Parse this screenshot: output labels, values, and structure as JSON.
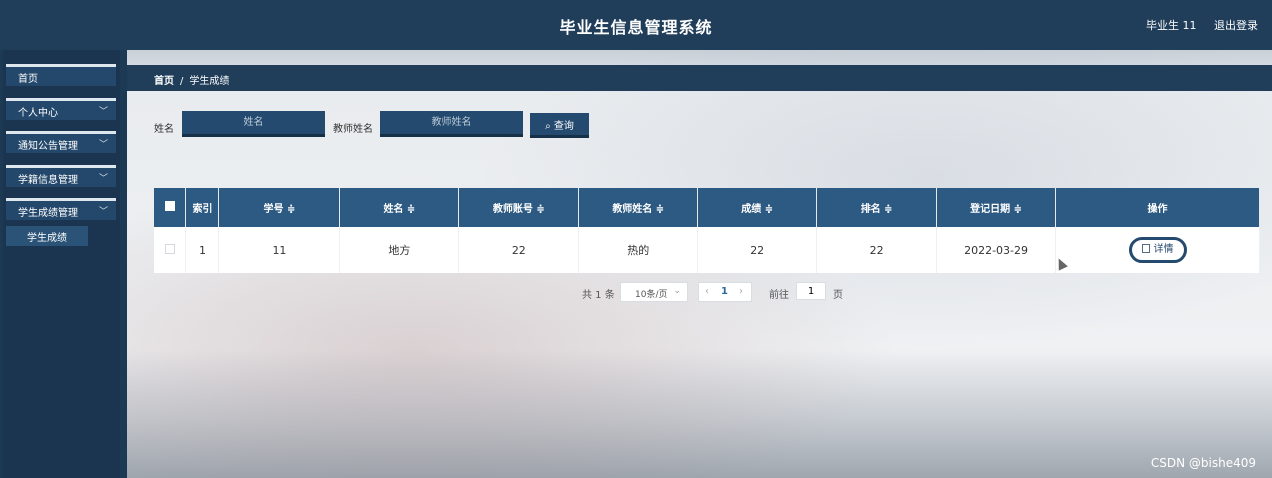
{
  "app": {
    "title": "毕业生信息管理系统",
    "user_label": "毕业生 11",
    "logout_label": "退出登录"
  },
  "sidebar": {
    "items": [
      {
        "label": "首页"
      },
      {
        "label": "个人中心"
      },
      {
        "label": "通知公告管理"
      },
      {
        "label": "学籍信息管理"
      },
      {
        "label": "学生成绩管理"
      }
    ],
    "submenu": {
      "label": "学生成绩"
    }
  },
  "breadcrumb": {
    "home": "首页",
    "separator": "/",
    "current": "学生成绩"
  },
  "search": {
    "name_label": "姓名",
    "name_placeholder": "姓名",
    "teacher_label": "教师姓名",
    "teacher_placeholder": "教师姓名",
    "query_label": "查询"
  },
  "table": {
    "headers": [
      "索引",
      "学号 ≑",
      "姓名 ≑",
      "教师账号 ≑",
      "教师姓名 ≑",
      "成绩 ≑",
      "排名 ≑",
      "登记日期 ≑",
      "操作"
    ],
    "rows": [
      {
        "index": "1",
        "student_id": "11",
        "name": "地方",
        "teacher_account": "22",
        "teacher_name": "热的",
        "score": "22",
        "rank": "22",
        "date": "2022-03-29",
        "action": "详情"
      }
    ]
  },
  "pagination": {
    "total": "共 1 条",
    "page_size": "10条/页",
    "current_page": "1",
    "goto_label": "前往",
    "goto_value": "1",
    "page_label": "页"
  },
  "watermark": "CSDN @bishe409",
  "colors": {
    "primary": "#244a6f",
    "header_bg": "#203e5a",
    "table_header": "#2c5a83"
  }
}
